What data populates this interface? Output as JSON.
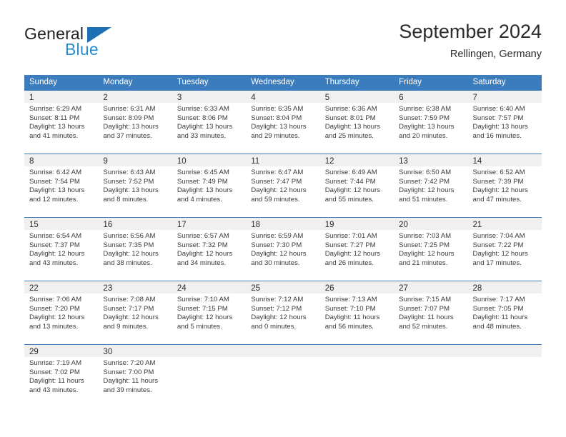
{
  "logo": {
    "word_top": "General",
    "word_bottom": "Blue",
    "triangle_color": "#1f6fb5",
    "blue_text_color": "#2b8ccd"
  },
  "header": {
    "title": "September 2024",
    "location": "Rellingen, Germany"
  },
  "theme": {
    "header_blue": "#3b7cbe",
    "day_band_gray": "#f0f0f0",
    "text_color": "#2b2b2b"
  },
  "weekdays": [
    "Sunday",
    "Monday",
    "Tuesday",
    "Wednesday",
    "Thursday",
    "Friday",
    "Saturday"
  ],
  "weeks": [
    [
      {
        "day": "1",
        "sunrise": "Sunrise: 6:29 AM",
        "sunset": "Sunset: 8:11 PM",
        "daylight1": "Daylight: 13 hours",
        "daylight2": "and 41 minutes."
      },
      {
        "day": "2",
        "sunrise": "Sunrise: 6:31 AM",
        "sunset": "Sunset: 8:09 PM",
        "daylight1": "Daylight: 13 hours",
        "daylight2": "and 37 minutes."
      },
      {
        "day": "3",
        "sunrise": "Sunrise: 6:33 AM",
        "sunset": "Sunset: 8:06 PM",
        "daylight1": "Daylight: 13 hours",
        "daylight2": "and 33 minutes."
      },
      {
        "day": "4",
        "sunrise": "Sunrise: 6:35 AM",
        "sunset": "Sunset: 8:04 PM",
        "daylight1": "Daylight: 13 hours",
        "daylight2": "and 29 minutes."
      },
      {
        "day": "5",
        "sunrise": "Sunrise: 6:36 AM",
        "sunset": "Sunset: 8:01 PM",
        "daylight1": "Daylight: 13 hours",
        "daylight2": "and 25 minutes."
      },
      {
        "day": "6",
        "sunrise": "Sunrise: 6:38 AM",
        "sunset": "Sunset: 7:59 PM",
        "daylight1": "Daylight: 13 hours",
        "daylight2": "and 20 minutes."
      },
      {
        "day": "7",
        "sunrise": "Sunrise: 6:40 AM",
        "sunset": "Sunset: 7:57 PM",
        "daylight1": "Daylight: 13 hours",
        "daylight2": "and 16 minutes."
      }
    ],
    [
      {
        "day": "8",
        "sunrise": "Sunrise: 6:42 AM",
        "sunset": "Sunset: 7:54 PM",
        "daylight1": "Daylight: 13 hours",
        "daylight2": "and 12 minutes."
      },
      {
        "day": "9",
        "sunrise": "Sunrise: 6:43 AM",
        "sunset": "Sunset: 7:52 PM",
        "daylight1": "Daylight: 13 hours",
        "daylight2": "and 8 minutes."
      },
      {
        "day": "10",
        "sunrise": "Sunrise: 6:45 AM",
        "sunset": "Sunset: 7:49 PM",
        "daylight1": "Daylight: 13 hours",
        "daylight2": "and 4 minutes."
      },
      {
        "day": "11",
        "sunrise": "Sunrise: 6:47 AM",
        "sunset": "Sunset: 7:47 PM",
        "daylight1": "Daylight: 12 hours",
        "daylight2": "and 59 minutes."
      },
      {
        "day": "12",
        "sunrise": "Sunrise: 6:49 AM",
        "sunset": "Sunset: 7:44 PM",
        "daylight1": "Daylight: 12 hours",
        "daylight2": "and 55 minutes."
      },
      {
        "day": "13",
        "sunrise": "Sunrise: 6:50 AM",
        "sunset": "Sunset: 7:42 PM",
        "daylight1": "Daylight: 12 hours",
        "daylight2": "and 51 minutes."
      },
      {
        "day": "14",
        "sunrise": "Sunrise: 6:52 AM",
        "sunset": "Sunset: 7:39 PM",
        "daylight1": "Daylight: 12 hours",
        "daylight2": "and 47 minutes."
      }
    ],
    [
      {
        "day": "15",
        "sunrise": "Sunrise: 6:54 AM",
        "sunset": "Sunset: 7:37 PM",
        "daylight1": "Daylight: 12 hours",
        "daylight2": "and 43 minutes."
      },
      {
        "day": "16",
        "sunrise": "Sunrise: 6:56 AM",
        "sunset": "Sunset: 7:35 PM",
        "daylight1": "Daylight: 12 hours",
        "daylight2": "and 38 minutes."
      },
      {
        "day": "17",
        "sunrise": "Sunrise: 6:57 AM",
        "sunset": "Sunset: 7:32 PM",
        "daylight1": "Daylight: 12 hours",
        "daylight2": "and 34 minutes."
      },
      {
        "day": "18",
        "sunrise": "Sunrise: 6:59 AM",
        "sunset": "Sunset: 7:30 PM",
        "daylight1": "Daylight: 12 hours",
        "daylight2": "and 30 minutes."
      },
      {
        "day": "19",
        "sunrise": "Sunrise: 7:01 AM",
        "sunset": "Sunset: 7:27 PM",
        "daylight1": "Daylight: 12 hours",
        "daylight2": "and 26 minutes."
      },
      {
        "day": "20",
        "sunrise": "Sunrise: 7:03 AM",
        "sunset": "Sunset: 7:25 PM",
        "daylight1": "Daylight: 12 hours",
        "daylight2": "and 21 minutes."
      },
      {
        "day": "21",
        "sunrise": "Sunrise: 7:04 AM",
        "sunset": "Sunset: 7:22 PM",
        "daylight1": "Daylight: 12 hours",
        "daylight2": "and 17 minutes."
      }
    ],
    [
      {
        "day": "22",
        "sunrise": "Sunrise: 7:06 AM",
        "sunset": "Sunset: 7:20 PM",
        "daylight1": "Daylight: 12 hours",
        "daylight2": "and 13 minutes."
      },
      {
        "day": "23",
        "sunrise": "Sunrise: 7:08 AM",
        "sunset": "Sunset: 7:17 PM",
        "daylight1": "Daylight: 12 hours",
        "daylight2": "and 9 minutes."
      },
      {
        "day": "24",
        "sunrise": "Sunrise: 7:10 AM",
        "sunset": "Sunset: 7:15 PM",
        "daylight1": "Daylight: 12 hours",
        "daylight2": "and 5 minutes."
      },
      {
        "day": "25",
        "sunrise": "Sunrise: 7:12 AM",
        "sunset": "Sunset: 7:12 PM",
        "daylight1": "Daylight: 12 hours",
        "daylight2": "and 0 minutes."
      },
      {
        "day": "26",
        "sunrise": "Sunrise: 7:13 AM",
        "sunset": "Sunset: 7:10 PM",
        "daylight1": "Daylight: 11 hours",
        "daylight2": "and 56 minutes."
      },
      {
        "day": "27",
        "sunrise": "Sunrise: 7:15 AM",
        "sunset": "Sunset: 7:07 PM",
        "daylight1": "Daylight: 11 hours",
        "daylight2": "and 52 minutes."
      },
      {
        "day": "28",
        "sunrise": "Sunrise: 7:17 AM",
        "sunset": "Sunset: 7:05 PM",
        "daylight1": "Daylight: 11 hours",
        "daylight2": "and 48 minutes."
      }
    ],
    [
      {
        "day": "29",
        "sunrise": "Sunrise: 7:19 AM",
        "sunset": "Sunset: 7:02 PM",
        "daylight1": "Daylight: 11 hours",
        "daylight2": "and 43 minutes."
      },
      {
        "day": "30",
        "sunrise": "Sunrise: 7:20 AM",
        "sunset": "Sunset: 7:00 PM",
        "daylight1": "Daylight: 11 hours",
        "daylight2": "and 39 minutes."
      },
      {
        "day": "",
        "sunrise": "",
        "sunset": "",
        "daylight1": "",
        "daylight2": ""
      },
      {
        "day": "",
        "sunrise": "",
        "sunset": "",
        "daylight1": "",
        "daylight2": ""
      },
      {
        "day": "",
        "sunrise": "",
        "sunset": "",
        "daylight1": "",
        "daylight2": ""
      },
      {
        "day": "",
        "sunrise": "",
        "sunset": "",
        "daylight1": "",
        "daylight2": ""
      },
      {
        "day": "",
        "sunrise": "",
        "sunset": "",
        "daylight1": "",
        "daylight2": ""
      }
    ]
  ]
}
